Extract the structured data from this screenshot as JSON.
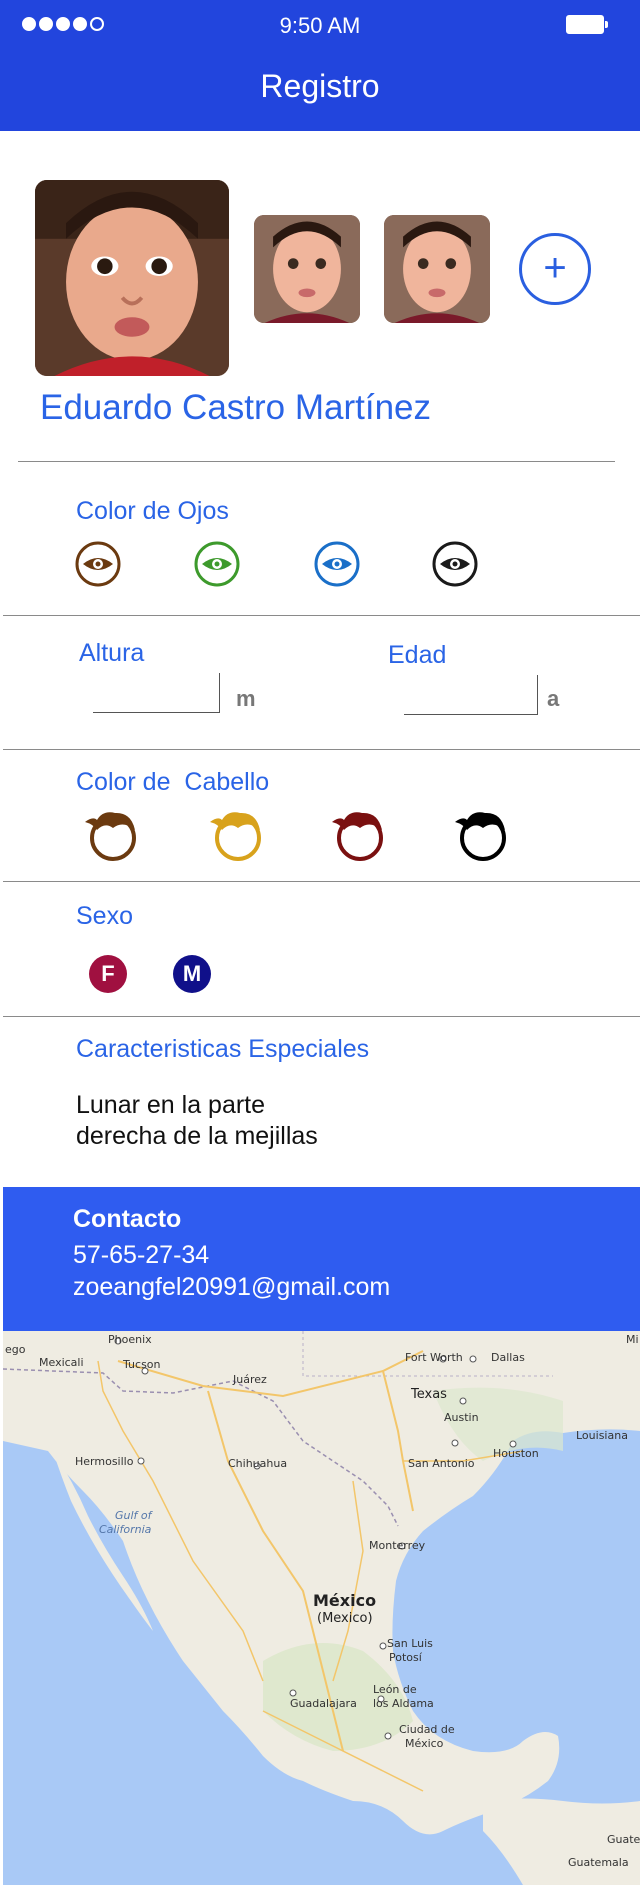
{
  "status_bar": {
    "time": "9:50 AM"
  },
  "header": {
    "title": "Registro"
  },
  "profile": {
    "name": "Eduardo Castro Martínez",
    "add_photo_label": "+"
  },
  "eye_color": {
    "label": "Color de Ojos",
    "options": [
      {
        "name": "brown",
        "color": "#6b3a10"
      },
      {
        "name": "green",
        "color": "#3d9a2c"
      },
      {
        "name": "blue",
        "color": "#1a6fc8"
      },
      {
        "name": "black",
        "color": "#1a1a1a"
      }
    ]
  },
  "measurements": {
    "height_label": "Altura",
    "height_unit": "m",
    "age_label": "Edad",
    "age_unit": "a"
  },
  "hair_color": {
    "label": "Color de  Cabello",
    "options": [
      {
        "name": "brown",
        "color": "#6b3a10"
      },
      {
        "name": "blonde",
        "color": "#d8a21c"
      },
      {
        "name": "red",
        "color": "#7a1010"
      },
      {
        "name": "black",
        "color": "#000000"
      }
    ]
  },
  "sex": {
    "label": "Sexo",
    "female": {
      "label": "F",
      "color": "#a01040"
    },
    "male": {
      "label": "M",
      "color": "#10108a"
    }
  },
  "special": {
    "label": "Caracteristicas Especiales",
    "line1": "Lunar en la parte",
    "line2": "derecha de la mejillas"
  },
  "contact": {
    "title": "Contacto",
    "phone": "57-65-27-34",
    "email": "zoeangfel20991@gmail.com"
  },
  "map": {
    "labels": {
      "phoenix": "Phoenix",
      "mexicali": "Mexicali",
      "tucson": "Tucson",
      "ego": "ego",
      "fort_worth": "Fort Worth",
      "dallas": "Dallas",
      "mi": "Mi",
      "juarez": "Juárez",
      "texas": "Texas",
      "austin": "Austin",
      "louisiana": "Louisiana",
      "hermosillo": "Hermosillo",
      "chihuahua": "Chihuahua",
      "san_antonio": "San Antonio",
      "houston": "Houston",
      "gulf_california_1": "Gulf of",
      "gulf_california_2": "California",
      "monterrey": "Monterrey",
      "mexico_1": "México",
      "mexico_2": "(Mexico)",
      "san_luis_1": "San Luis",
      "san_luis_2": "Potosí",
      "guadalajara": "Guadalajara",
      "leon_1": "León de",
      "leon_2": "los Aldama",
      "ciudad_mexico_1": "Ciudad de",
      "ciudad_mexico_2": "México",
      "guate": "Guate",
      "guatemala": "Guatemala"
    }
  }
}
